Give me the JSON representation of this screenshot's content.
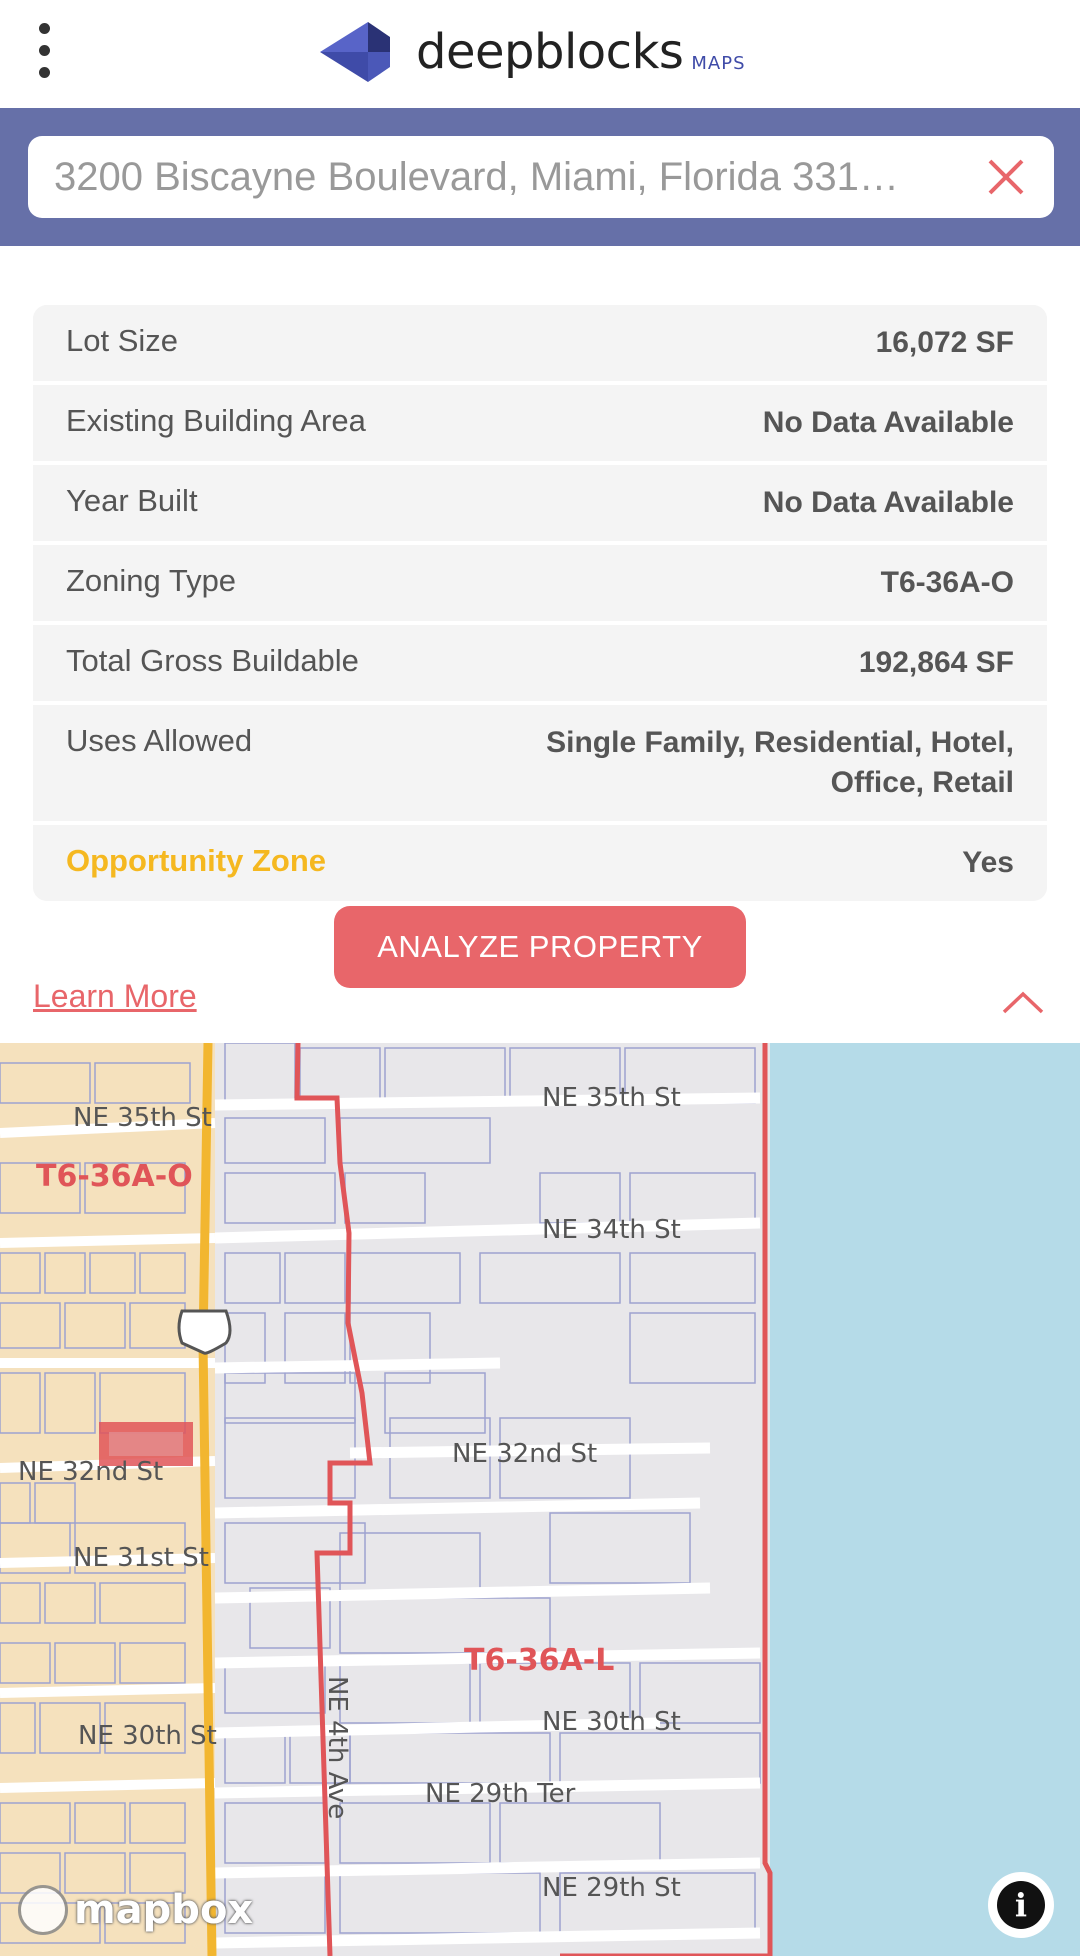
{
  "header": {
    "brand_name": "deepblocks",
    "brand_sub": "MAPS",
    "colors": {
      "brand_blue": "#3f4ba8",
      "band": "#6670a8"
    }
  },
  "search": {
    "value": "3200 Biscayne Boulevard, Miami, Florida 331…",
    "clear_icon": "close-icon"
  },
  "property": {
    "rows": [
      {
        "label": "Lot Size",
        "value": "16,072 SF"
      },
      {
        "label": "Existing Building Area",
        "value": "No Data Available"
      },
      {
        "label": "Year Built",
        "value": "No Data Available"
      },
      {
        "label": "Zoning Type",
        "value": "T6-36A-O"
      },
      {
        "label": "Total Gross Buildable",
        "value": "192,864 SF"
      },
      {
        "label": "Uses Allowed",
        "value": "Single Family, Residential, Hotel, Office, Retail"
      },
      {
        "label": "Opportunity Zone",
        "value": "Yes"
      }
    ],
    "opportunity_color": "#f5b820"
  },
  "actions": {
    "analyze_label": "ANALYZE PROPERTY",
    "learn_more_label": "Learn More",
    "accent_color": "#e8666a"
  },
  "map": {
    "streets": {
      "ne35_left": "NE 35th St",
      "ne35_right": "NE 35th St",
      "ne34": "NE 34th St",
      "ne32_left": "NE 32nd St",
      "ne32_right": "NE 32nd St",
      "ne31": "NE 31st St",
      "ne30_left": "NE 30th St",
      "ne30_right": "NE 30th St",
      "ne29ter": "NE 29th Ter",
      "ne29st": "NE 29th St",
      "ne4ave": "NE 4th Ave"
    },
    "zones": {
      "left": "T6-36A-O",
      "center": "T6-36A-L"
    },
    "attribution": "mapbox",
    "colors": {
      "water": "#b5dbe8",
      "zone_left": "#f5e1bd",
      "zone_border": "#e05558",
      "highway": "#f2b630",
      "parcel_line": "#9da2d0"
    }
  }
}
